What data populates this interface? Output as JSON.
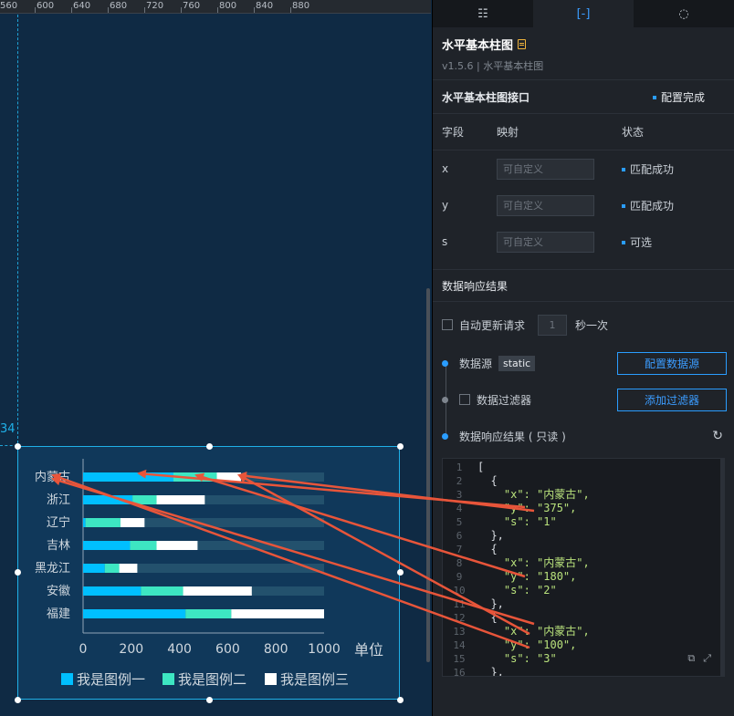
{
  "ruler": {
    "ticks": [
      "560",
      "600",
      "640",
      "680",
      "720",
      "760",
      "800",
      "840",
      "880"
    ]
  },
  "canvas": {
    "guide_number": "34"
  },
  "chart_data": {
    "type": "bar",
    "orientation": "horizontal",
    "stacked": true,
    "categories": [
      "内蒙古",
      "浙江",
      "辽宁",
      "吉林",
      "黑龙江",
      "安徽",
      "福建"
    ],
    "series": [
      {
        "name": "我是图例一",
        "values": [
          375,
          205,
          10,
          195,
          90,
          240,
          425
        ],
        "color": "#00bfff"
      },
      {
        "name": "我是图例二",
        "values": [
          180,
          100,
          145,
          110,
          60,
          175,
          190
        ],
        "color": "#3de6c2"
      },
      {
        "name": "我是图例三",
        "values": [
          100,
          200,
          100,
          170,
          75,
          285,
          385
        ],
        "color": "#ffffff"
      }
    ],
    "xticks": [
      "0",
      "200",
      "400",
      "600",
      "800",
      "1000"
    ],
    "xlim": [
      0,
      1000
    ],
    "unit_label": "单位",
    "track_color": "#23516d",
    "legend_position": "bottom"
  },
  "panel": {
    "tabs": [
      {
        "name": "tab-style",
        "icon": "☷"
      },
      {
        "name": "tab-data",
        "icon": "[-]"
      },
      {
        "name": "tab-interaction",
        "icon": "◌"
      }
    ],
    "title": "水平基本柱图",
    "subtitle": "v1.5.6 | 水平基本柱图",
    "interface_title": "水平基本柱图接口",
    "interface_status": "配置完成",
    "headers": {
      "field": "字段",
      "map": "映射",
      "status": "状态"
    },
    "fields": [
      {
        "name": "x",
        "placeholder": "可自定义",
        "status": "匹配成功"
      },
      {
        "name": "y",
        "placeholder": "可自定义",
        "status": "匹配成功"
      },
      {
        "name": "s",
        "placeholder": "可自定义",
        "status": "可选"
      }
    ],
    "response_title": "数据响应结果",
    "auto_update": {
      "label": "自动更新请求",
      "value": "1",
      "suffix": "秒一次"
    },
    "datasource": {
      "label": "数据源",
      "tag": "static",
      "button": "配置数据源"
    },
    "filter": {
      "label": "数据过滤器",
      "button": "添加过滤器"
    },
    "result_label": "数据响应结果 ( 只读 )",
    "code_lines": [
      {
        "n": "1",
        "t": "["
      },
      {
        "n": "2",
        "t": "  {"
      },
      {
        "n": "3",
        "t": "    \"x\": \"内蒙古\","
      },
      {
        "n": "4",
        "t": "    \"y\": \"375\","
      },
      {
        "n": "5",
        "t": "    \"s\": \"1\""
      },
      {
        "n": "6",
        "t": "  },"
      },
      {
        "n": "7",
        "t": "  {"
      },
      {
        "n": "8",
        "t": "    \"x\": \"内蒙古\","
      },
      {
        "n": "9",
        "t": "    \"y\": \"180\","
      },
      {
        "n": "10",
        "t": "    \"s\": \"2\""
      },
      {
        "n": "11",
        "t": "  },"
      },
      {
        "n": "12",
        "t": "  {"
      },
      {
        "n": "13",
        "t": "    \"x\": \"内蒙古\","
      },
      {
        "n": "14",
        "t": "    \"y\": \"100\","
      },
      {
        "n": "15",
        "t": "    \"s\": \"3\""
      },
      {
        "n": "16",
        "t": "  },"
      }
    ],
    "code_icons": [
      "⧉",
      "⤢"
    ]
  },
  "arrow_color": "#e8553a"
}
